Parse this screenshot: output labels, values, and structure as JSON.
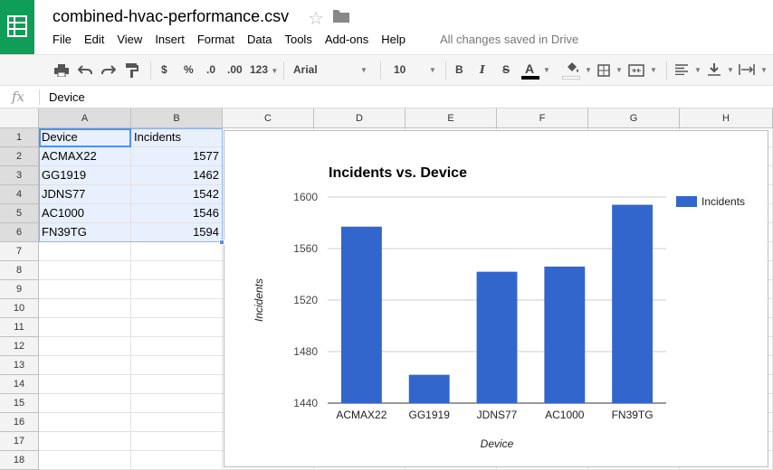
{
  "document": {
    "title": "combined-hvac-performance.csv",
    "save_status": "All changes saved in Drive"
  },
  "menu": [
    "File",
    "Edit",
    "View",
    "Insert",
    "Format",
    "Data",
    "Tools",
    "Add-ons",
    "Help"
  ],
  "toolbar": {
    "currency": "$",
    "percent": "%",
    "decrease_decimal": ".0",
    "increase_decimal": ".00",
    "number_format": "123",
    "font_family": "Arial",
    "font_size": "10",
    "bold": "B",
    "italic": "I",
    "strikethrough": "S",
    "text_color": "A",
    "icons": [
      "print-icon",
      "undo-icon",
      "redo-icon",
      "paint-format-icon",
      "fill-color-icon",
      "borders-icon",
      "merge-icon",
      "align-left-icon",
      "valign-bottom-icon",
      "text-wrap-icon"
    ]
  },
  "formula_bar": {
    "fx": "fx",
    "value": "Device"
  },
  "columns": [
    "A",
    "B",
    "C",
    "D",
    "E",
    "F",
    "G",
    "H"
  ],
  "rows": [
    "1",
    "2",
    "3",
    "4",
    "5",
    "6",
    "7",
    "8",
    "9",
    "10",
    "11",
    "12",
    "13",
    "14",
    "15",
    "16",
    "17",
    "18"
  ],
  "cells": [
    [
      "Device",
      "Incidents"
    ],
    [
      "ACMAX22",
      "1577"
    ],
    [
      "GG1919",
      "1462"
    ],
    [
      "JDNS77",
      "1542"
    ],
    [
      "AC1000",
      "1546"
    ],
    [
      "FN39TG",
      "1594"
    ]
  ],
  "colors": {
    "bar": "#3366cc",
    "brand": "#0f9d58",
    "selection": "#4d90fe"
  },
  "chart_data": {
    "type": "bar",
    "title": "Incidents vs. Device",
    "xlabel": "Device",
    "ylabel": "Incidents",
    "categories": [
      "ACMAX22",
      "GG1919",
      "JDNS77",
      "AC1000",
      "FN39TG"
    ],
    "series": [
      {
        "name": "Incidents",
        "values": [
          1577,
          1462,
          1542,
          1546,
          1594
        ]
      }
    ],
    "ylim": [
      1440,
      1600
    ],
    "yticks": [
      "1440",
      "1480",
      "1520",
      "1560",
      "1600"
    ],
    "grid": true,
    "legend": "right"
  }
}
